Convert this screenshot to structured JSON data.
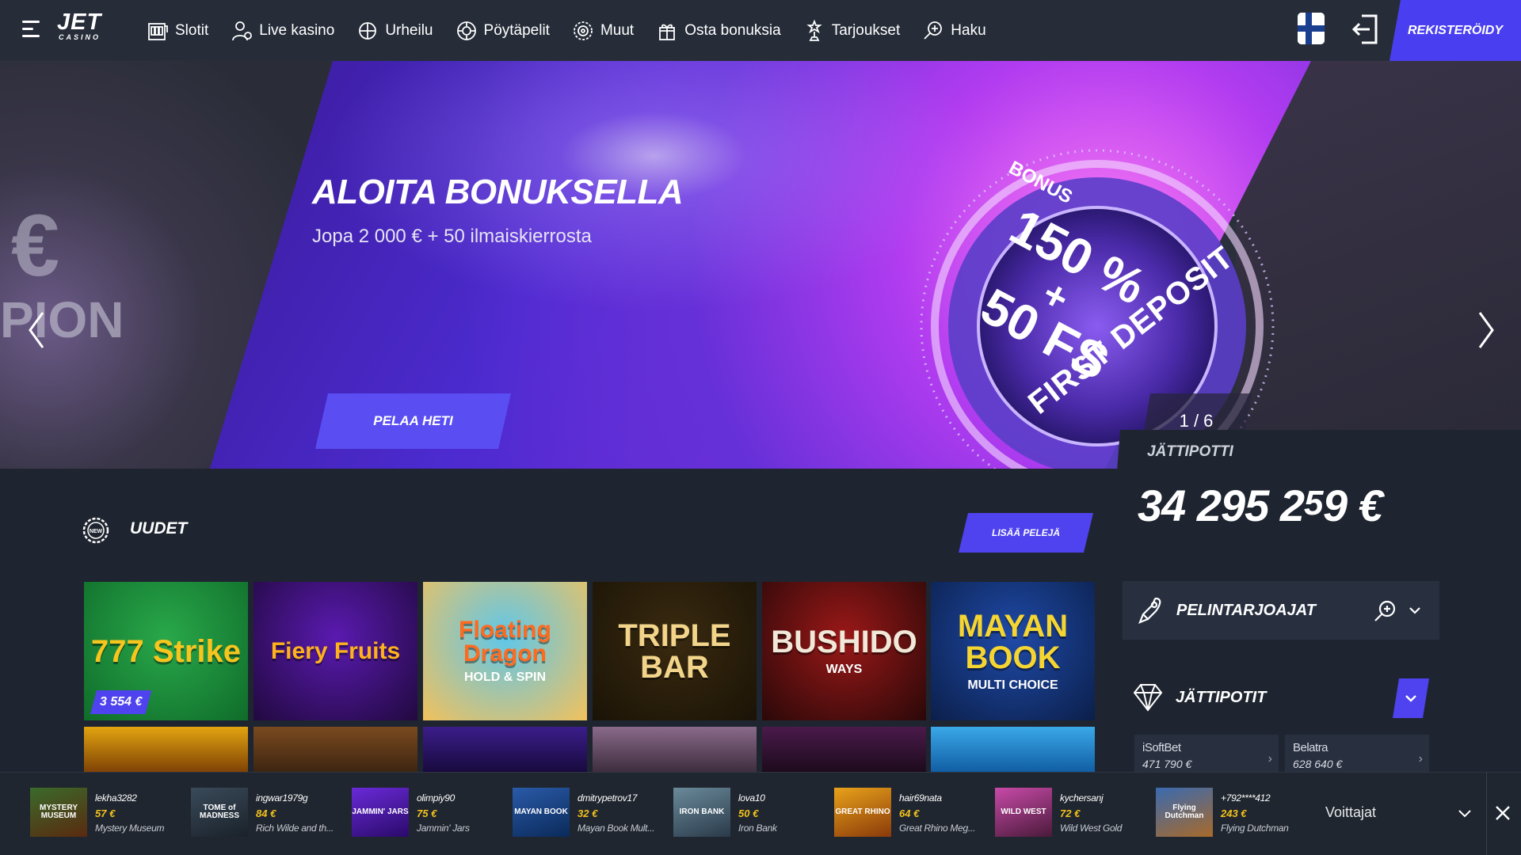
{
  "header": {
    "logo_main": "JET",
    "logo_sub": "CASINO",
    "nav": [
      {
        "label": "Slotit",
        "icon": "slot-machine-icon"
      },
      {
        "label": "Live kasino",
        "icon": "dealer-icon"
      },
      {
        "label": "Urheilu",
        "icon": "sports-icon"
      },
      {
        "label": "Pöytäpelit",
        "icon": "roulette-chip-icon"
      },
      {
        "label": "Muut",
        "icon": "wheel-icon"
      },
      {
        "label": "Osta bonuksia",
        "icon": "gift-icon"
      },
      {
        "label": "Tarjoukset",
        "icon": "star-trophy-icon"
      },
      {
        "label": "Haku",
        "icon": "search-icon"
      }
    ],
    "register_label": "REKISTERÖIDY"
  },
  "hero": {
    "title": "ALOITA BONUKSELLA",
    "subtitle": "Jopa 2 000 € + 50 ilmaiskierrosta",
    "play_label": "PELAA HETI",
    "counter": "1 / 6",
    "badge": {
      "top": "BONUS",
      "line1": "150 %",
      "line2": "+",
      "line3": "50 FS",
      "bottom": "FIRST DEPOSIT"
    },
    "ghost_text": "PION",
    "ghost_symbol": "€"
  },
  "jackpot": {
    "label": "JÄTTIPOTTI",
    "amount": "34 295 2",
    "amount_tail": "9 €"
  },
  "new_games": {
    "title": "UUDET",
    "icon_text": "NEW",
    "more_label": "LISÄÄ PELEJÄ",
    "tiles": [
      {
        "name": "777 Strike",
        "price": "3 554 €",
        "colors": [
          "#29a84a",
          "#0f6c2a"
        ],
        "text_color": "#f7c51e"
      },
      {
        "name": "Fiery Fruits",
        "colors": [
          "#5a1ab0",
          "#21093f"
        ],
        "text_color": "#ffb21c"
      },
      {
        "name": "Floating Dragon",
        "sub": "HOLD & SPIN",
        "colors": [
          "#5fc7ea",
          "#f2c15c"
        ],
        "text_color": "#ff6a1f"
      },
      {
        "name": "TRIPLE BAR",
        "colors": [
          "#3a2a10",
          "#1a1306"
        ],
        "text_color": "#f2d48a"
      },
      {
        "name": "BUSHIDO",
        "sub": "WAYS",
        "colors": [
          "#9b1818",
          "#2a0808"
        ],
        "text_color": "#f0e8d8"
      },
      {
        "name": "MAYAN BOOK",
        "sub": "MULTI CHOICE",
        "colors": [
          "#1f4aa8",
          "#0b1f4a"
        ],
        "text_color": "#f5d531"
      }
    ],
    "row2": [
      {
        "colors": [
          "#e2a40f",
          "#7a3d05"
        ]
      },
      {
        "colors": [
          "#7a4a1f",
          "#3a2310"
        ]
      },
      {
        "colors": [
          "#3b1d8a",
          "#16093a"
        ]
      },
      {
        "colors": [
          "#8a6a8a",
          "#3a2a3a"
        ]
      },
      {
        "colors": [
          "#4a1a4a",
          "#1a0a1a"
        ]
      },
      {
        "colors": [
          "#3aa8e8",
          "#0f5aa0"
        ]
      }
    ]
  },
  "sidebar": {
    "providers_label": "PELINTARJOAJAT",
    "jackpots_label": "JÄTTIPOTIT",
    "jackpot_cards": [
      {
        "provider": "iSoftBet",
        "amount": "471 790 €"
      },
      {
        "provider": "Belatra",
        "amount": "628 640 €"
      }
    ]
  },
  "winners": {
    "label": "Voittajat",
    "items": [
      {
        "user": "lekha3282",
        "amount": "57 €",
        "game": "Mystery Museum",
        "thumb": "MYSTERY MUSEUM",
        "colors": [
          "#3a6a2a",
          "#5a2a10"
        ]
      },
      {
        "user": "ingwar1979g",
        "amount": "84 €",
        "game": "Rich Wilde and th...",
        "thumb": "TOME of MADNESS",
        "colors": [
          "#3a4a5a",
          "#1a222a"
        ]
      },
      {
        "user": "olimpiy90",
        "amount": "75 €",
        "game": "Jammin' Jars",
        "thumb": "JAMMIN' JARS",
        "colors": [
          "#6a2ad8",
          "#2a0a6a"
        ]
      },
      {
        "user": "dmitrypetrov17",
        "amount": "32 €",
        "game": "Mayan Book Mult...",
        "thumb": "MAYAN BOOK",
        "colors": [
          "#2a5aa8",
          "#0a2a5a"
        ]
      },
      {
        "user": "lova10",
        "amount": "50 €",
        "game": "Iron Bank",
        "thumb": "IRON BANK",
        "colors": [
          "#6a8a9a",
          "#2a3a4a"
        ]
      },
      {
        "user": "hair69nata",
        "amount": "64 €",
        "game": "Great Rhino Meg...",
        "thumb": "GREAT RHINO",
        "colors": [
          "#e8a21a",
          "#8a3a0a"
        ]
      },
      {
        "user": "kychersanj",
        "amount": "72 €",
        "game": "Wild West Gold",
        "thumb": "WILD WEST",
        "colors": [
          "#c84aa8",
          "#4a1a3a"
        ]
      },
      {
        "user": "+792****412",
        "amount": "243 €",
        "game": "Flying Dutchman",
        "thumb": "Flying Dutchman",
        "colors": [
          "#3a6ab0",
          "#a86a2a"
        ]
      }
    ]
  }
}
